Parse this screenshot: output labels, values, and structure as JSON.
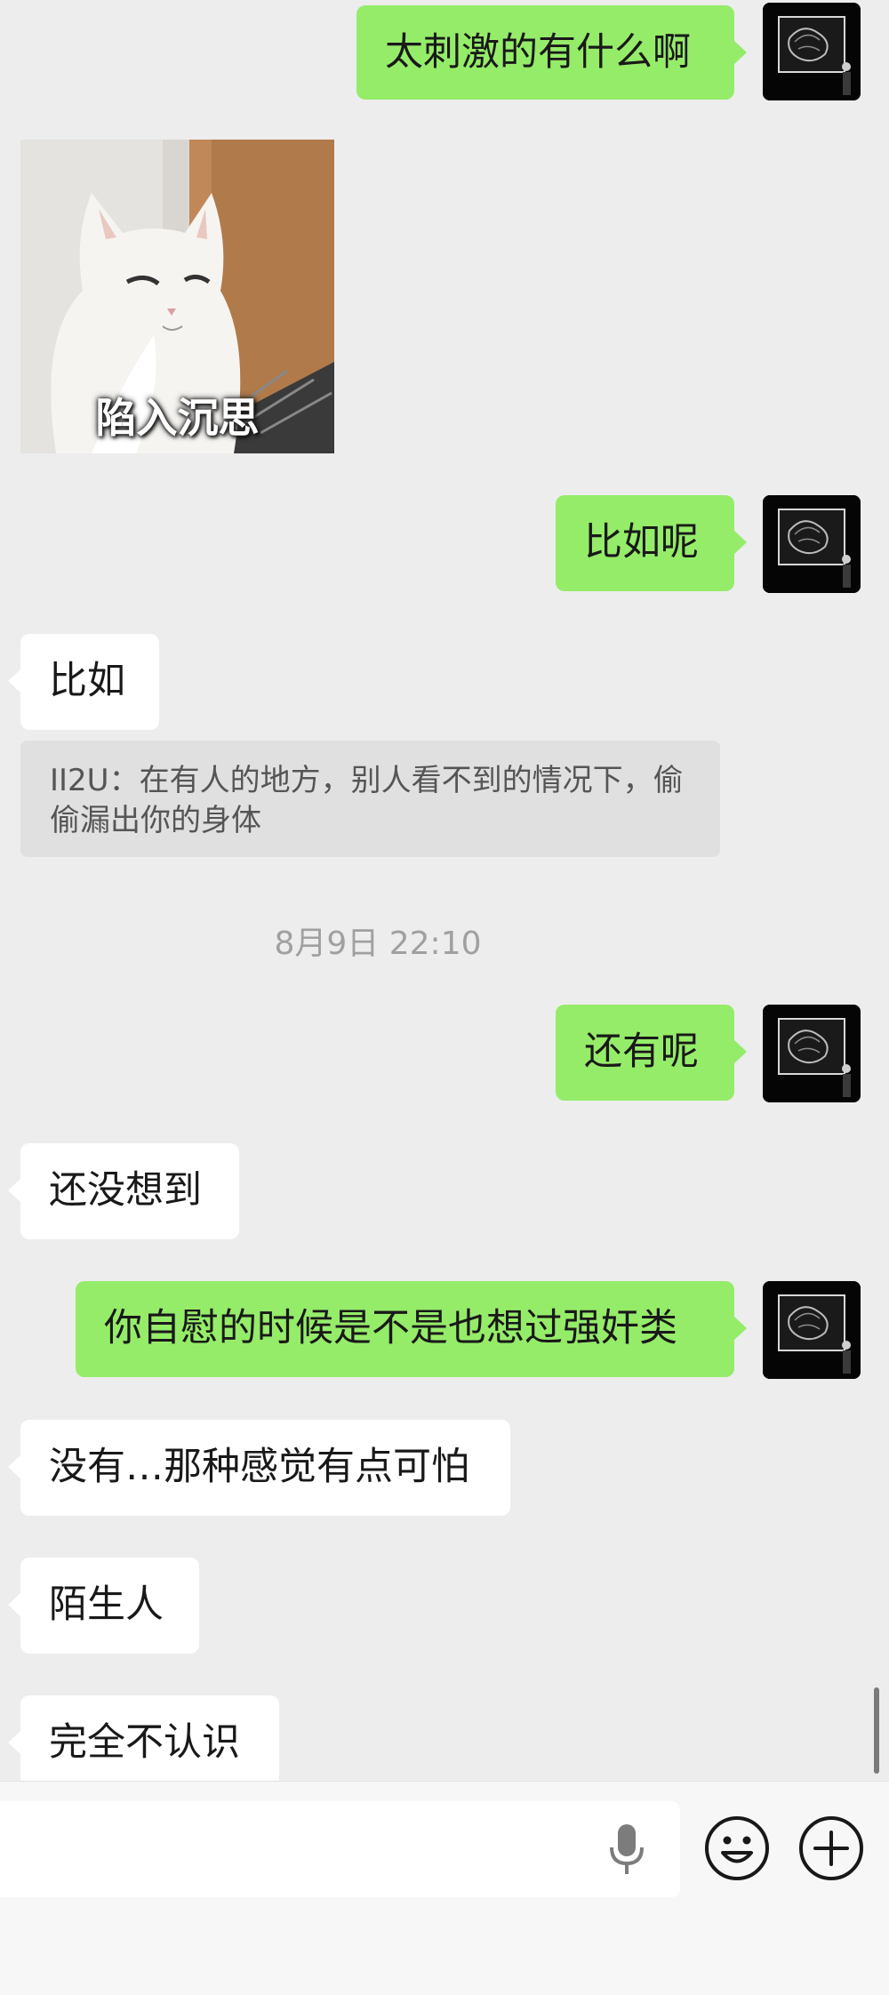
{
  "messages": {
    "m1": "太刺激的有什么啊",
    "m2_sticker_caption": "陷入沉思",
    "m3": "比如呢",
    "m4": "比如",
    "m5_quote": "II2U：在有人的地方，别人看不到的情况下，偷偷漏出你的身体",
    "timestamp": "8月9日 22:10",
    "m6": "还有呢",
    "m7": "还没想到",
    "m8": "你自慰的时候是不是也想过强奸类",
    "m9": "没有…那种感觉有点可怕",
    "m10": "陌生人",
    "m11": "完全不认识"
  },
  "colors": {
    "background": "#ededed",
    "outgoing_bubble": "#95ec69",
    "incoming_bubble": "#ffffff",
    "quote_bg": "#e0e0e0",
    "timestamp": "#a0a0a0",
    "input_bar": "#f7f7f7"
  },
  "icons": {
    "voice": "microphone-icon",
    "emoji": "emoji-icon",
    "more": "plus-icon",
    "avatar": "dark-artwork-avatar"
  }
}
